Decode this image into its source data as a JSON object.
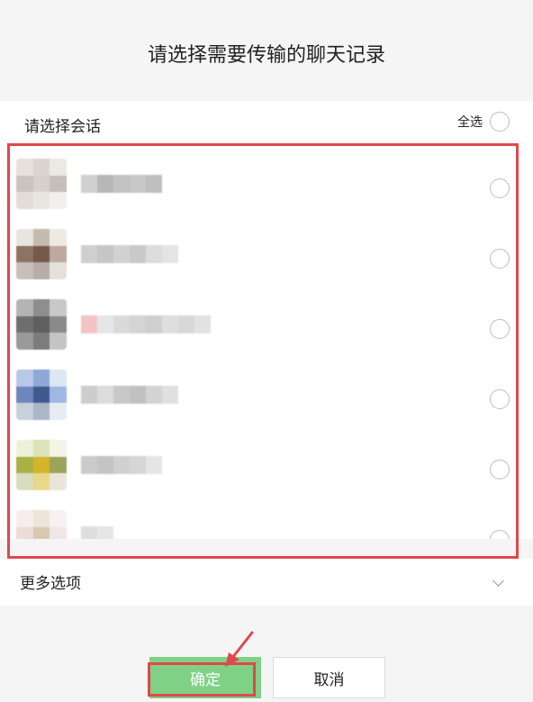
{
  "dialog": {
    "title": "请选择需要传输的聊天记录"
  },
  "section": {
    "label": "请选择会话",
    "select_all_label": "全选"
  },
  "chats": [
    {
      "avatar": [
        "#e6e1dc",
        "#d9d4cf",
        "#ece8e4",
        "#c9c4bf",
        "#d6d1cc",
        "#c4bfba",
        "#e2ddd8",
        "#e9e5e1",
        "#f2efec"
      ],
      "name_blocks": [
        "#d0d0d0",
        "#b8b8b8",
        "#c2c2c2",
        "#c8c8c8",
        "#bfbfbf"
      ]
    },
    {
      "avatar": [
        "#e8e4e0",
        "#c5bab0",
        "#efe9e4",
        "#8e7363",
        "#76594a",
        "#bba99d",
        "#c8bfba",
        "#b7aca6",
        "#e5e0dc"
      ],
      "name_blocks": [
        "#cfcfcf",
        "#c6c6c6",
        "#d2d2d2",
        "#c9c9c9",
        "#dcdcdc",
        "#e4e4e4"
      ]
    },
    {
      "avatar": [
        "#b4b4b4",
        "#8e8e8e",
        "#c8c8c8",
        "#6e6e6e",
        "#5f5f5f",
        "#8a8a8a",
        "#9a9a9a",
        "#7c7c7c",
        "#c4c4c4"
      ],
      "name_blocks": [
        "#f2c4c4",
        "#e6e6e6",
        "#dadada",
        "#d4d4d4",
        "#cfcfcf",
        "#dedede",
        "#d8d8d8",
        "#e2e2e2"
      ]
    },
    {
      "avatar": [
        "#b8c8e8",
        "#8ea8d8",
        "#dde6f2",
        "#6f86bd",
        "#3f5a8e",
        "#9eb8e3",
        "#c8d0dc",
        "#aab6c9",
        "#e7ecf3"
      ],
      "name_blocks": [
        "#cdcdcd",
        "#dcdcdc",
        "#c8c8c8",
        "#c1c1c1",
        "#d3d3d3",
        "#e0e0e0"
      ]
    },
    {
      "avatar": [
        "#eef1d9",
        "#dde3b8",
        "#f3f3e6",
        "#a9b046",
        "#d4b52a",
        "#9ca35c",
        "#d8dcc0",
        "#e8d88a",
        "#e8e6d8"
      ],
      "name_blocks": [
        "#cbcbcb",
        "#c4c4c4",
        "#d0d0d0",
        "#d6d6d6",
        "#e5e5e5"
      ]
    },
    {
      "avatar": [
        "#f7eded",
        "#efe4d9",
        "#f6f2f2",
        "#eadcd8",
        "#d8c8b2",
        "#f1e6e6",
        "#f2efe9",
        "#efe3b5",
        "#f5f2f2"
      ],
      "name_blocks": [
        "#dedede",
        "#e6e6e6"
      ]
    }
  ],
  "more_options": {
    "label": "更多选项"
  },
  "buttons": {
    "confirm": "确定",
    "cancel": "取消"
  },
  "colors": {
    "confirm_bg": "#7fd186",
    "highlight": "#e0474c",
    "background": "#f5f5f5"
  }
}
